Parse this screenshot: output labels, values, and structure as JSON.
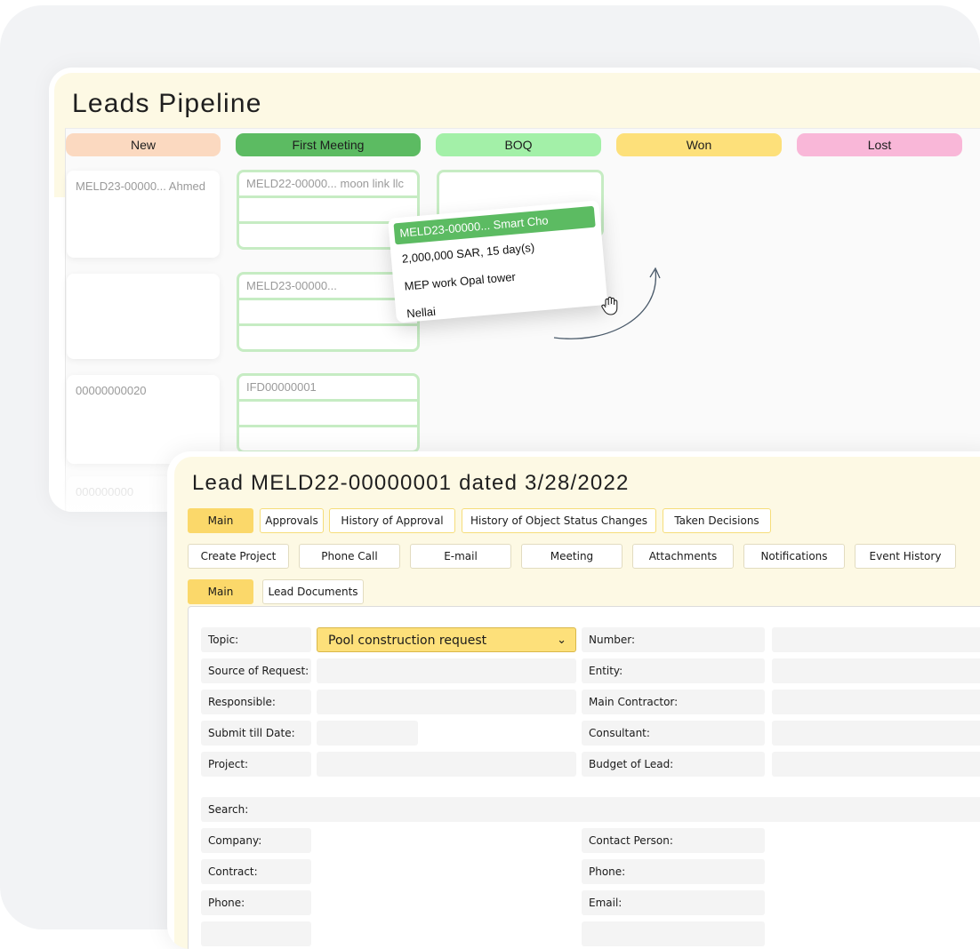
{
  "pipeline": {
    "title": "Leads Pipeline",
    "stages": [
      {
        "label": "New",
        "color": "#fbd9c0"
      },
      {
        "label": "First Meeting",
        "color": "#5cbb62"
      },
      {
        "label": "BOQ",
        "color": "#a3f0a8"
      },
      {
        "label": "Won",
        "color": "#fde07a"
      },
      {
        "label": "Lost",
        "color": "#f9b7d8"
      }
    ],
    "new_cards": [
      "MELD23-00000... Ahmed",
      "",
      "00000000020",
      "000000000"
    ],
    "first_meeting_cards": [
      "MELD22-00000... moon link llc",
      "MELD23-00000...",
      "IFD00000001"
    ],
    "dragged_card": {
      "title": "MELD23-00000... Smart Cho",
      "amount": "2,000,000 SAR, 15 day(s)",
      "description": "MEP work Opal tower",
      "name": "Nellai"
    }
  },
  "lead": {
    "title": "Lead MELD22-00000001 dated 3/28/2022",
    "tabs_row1": [
      "Main",
      "Approvals",
      "History of Approval",
      "History of Object Status Changes",
      "Taken Decisions"
    ],
    "tabs_row2": [
      "Create Project",
      "Phone Call",
      "E-mail",
      "Meeting",
      "Attachments",
      "Notifications",
      "Event History"
    ],
    "tabs_row3": [
      "Main",
      "Lead Documents"
    ],
    "form": {
      "topic_label": "Topic:",
      "topic_value": "Pool construction request",
      "source_label": "Source of Request:",
      "responsible_label": "Responsible:",
      "submit_label": "Submit till Date:",
      "project_label": "Project:",
      "number_label": "Number:",
      "entity_label": "Entity:",
      "main_contractor_label": "Main Contractor:",
      "consultant_label": "Consultant:",
      "budget_label": "Budget of Lead:",
      "search_label": "Search:",
      "company_label": "Company:",
      "contract_label": "Contract:",
      "phone_label_left": "Phone:",
      "contact_person_label": "Contact Person:",
      "phone_label_right": "Phone:",
      "email_label": "Email:"
    }
  }
}
